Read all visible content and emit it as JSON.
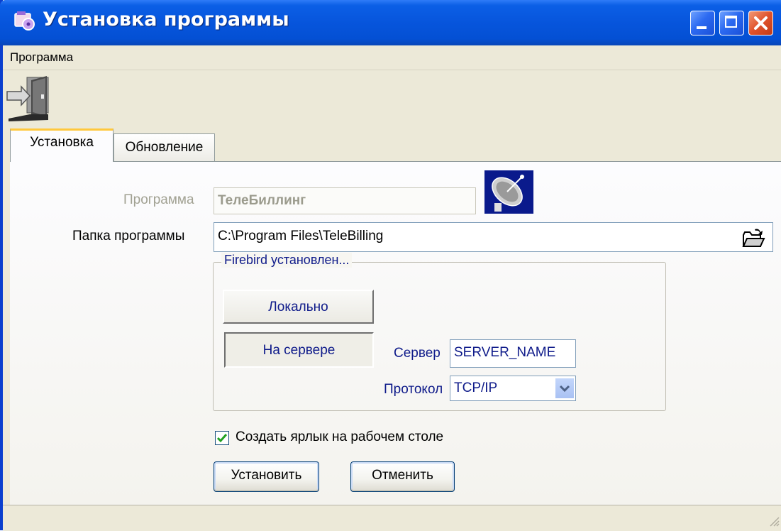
{
  "window": {
    "title": "Установка программы"
  },
  "menubar": {
    "items": [
      {
        "label": "Программа"
      }
    ]
  },
  "toolbar": {
    "exit_icon": "exit-door-icon"
  },
  "tabs": [
    {
      "label": "Установка",
      "selected": true
    },
    {
      "label": "Обновление",
      "selected": false
    }
  ],
  "form": {
    "program_label": "Программа",
    "program_value": "ТелеБиллинг",
    "program_icon": "satellite-dish-icon",
    "folder_label": "Папка программы",
    "folder_value": "C:\\Program Files\\TeleBilling",
    "folder_button_icon": "folder-open-icon",
    "firebird_group": {
      "legend": "Firebird установлен...",
      "local_button": "Локально",
      "server_button": "На сервере",
      "server_label": "Сервер",
      "server_value": "SERVER_NAME",
      "protocol_label": "Протокол",
      "protocol_value": "TCP/IP"
    },
    "shortcut_checkbox": {
      "label": "Создать ярлык на рабочем столе",
      "checked": true
    },
    "install_button": "Установить",
    "cancel_button": "Отменить"
  },
  "colors": {
    "titlebar": "#0755dc",
    "label_blue": "#0f1b8a",
    "disabled_text": "#a1a192"
  }
}
